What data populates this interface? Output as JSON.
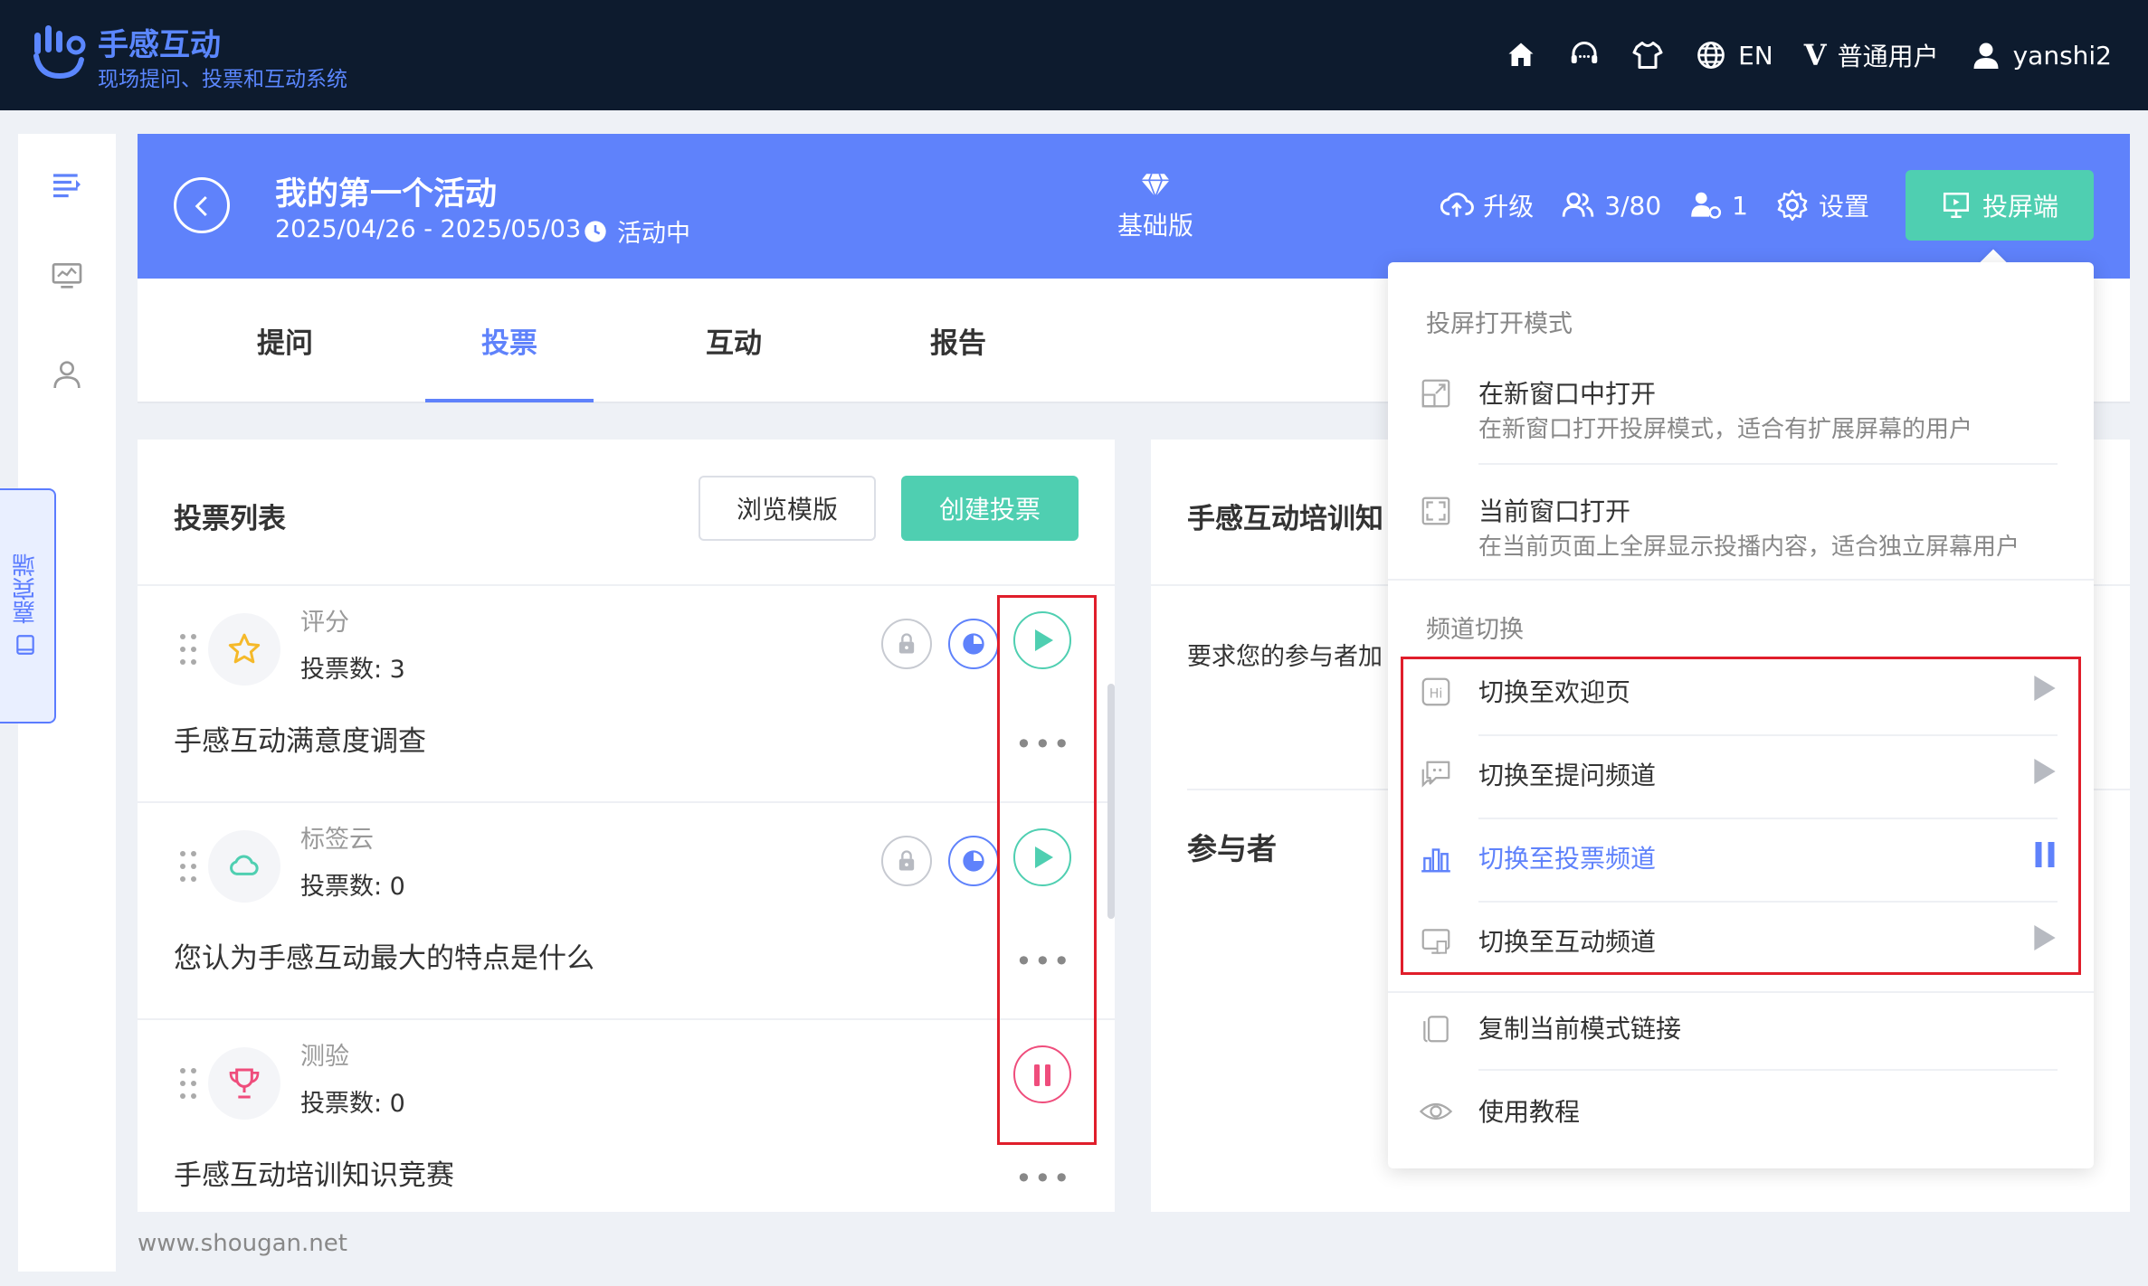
{
  "app": {
    "name": "手感互动",
    "subtitle": "现场提问、投票和互动系统",
    "lang": "EN",
    "user_role": "普通用户",
    "username": "yanshi2",
    "brand_color": "#5b87ff"
  },
  "sidebar": {
    "guest_tab": "嘉宾端"
  },
  "event": {
    "title": "我的第一个活动",
    "dates": "2025/04/26 - 2025/05/03",
    "status": "活动中",
    "plan": "基础版",
    "upgrade": "升级",
    "participants": "3/80",
    "online": "1",
    "settings": "设置",
    "projector": "投屏端",
    "banner_color": "#5f82fb"
  },
  "tabs": [
    "提问",
    "投票",
    "互动",
    "报告"
  ],
  "active_tab": "投票",
  "vote_panel": {
    "title": "投票列表",
    "browse_label": "浏览模版",
    "create_label": "创建投票",
    "accent": "#4fcfb1"
  },
  "polls": [
    {
      "type": "评分",
      "count": "投票数: 3",
      "name": "手感互动满意度调查",
      "icon": "star-icon",
      "state": "play"
    },
    {
      "type": "标签云",
      "count": "投票数: 0",
      "name": "您认为手感互动最大的特点是什么",
      "icon": "cloud-icon",
      "state": "play"
    },
    {
      "type": "测验",
      "count": "投票数: 0",
      "name": "手感互动培训知识竞赛",
      "icon": "trophy-icon",
      "state": "pause"
    }
  ],
  "right_panel": {
    "title": "手感互动培训知",
    "desc": "要求您的参与者加",
    "participants_title": "参与者"
  },
  "dropdown": {
    "mode_header": "投屏打开模式",
    "new_window": "在新窗口中打开",
    "new_window_desc": "在新窗口打开投屏模式，适合有扩展屏幕的用户",
    "current_window": "当前窗口打开",
    "current_window_desc": "在当前页面上全屏显示投播内容，适合独立屏幕用户",
    "channel_header": "频道切换",
    "channels": [
      {
        "label": "切换至欢迎页",
        "icon": "hi-icon",
        "active": false
      },
      {
        "label": "切换至提问频道",
        "icon": "chat-icon",
        "active": false
      },
      {
        "label": "切换至投票频道",
        "icon": "bar-chart-icon",
        "active": true
      },
      {
        "label": "切换至互动频道",
        "icon": "screen-icon",
        "active": false
      }
    ],
    "copy_link": "复制当前模式链接",
    "tutorial": "使用教程"
  },
  "footer": "www.shougan.net"
}
